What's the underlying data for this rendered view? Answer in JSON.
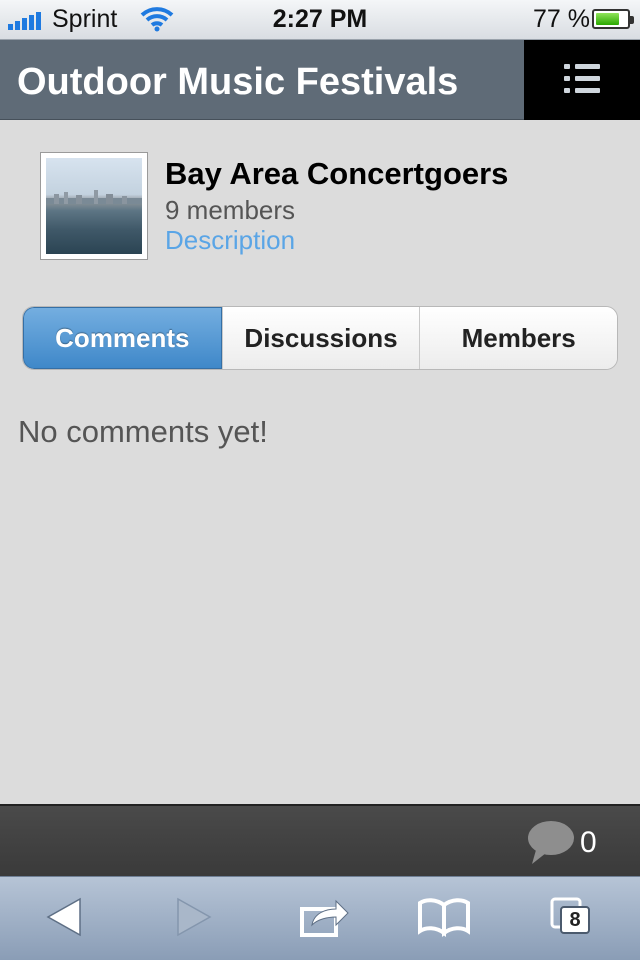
{
  "status_bar": {
    "carrier": "Sprint",
    "time": "2:27 PM",
    "battery_percent": "77 %",
    "battery_level": 0.77,
    "icons": [
      "signal-icon",
      "wifi-icon",
      "battery-icon"
    ]
  },
  "header": {
    "title": "Outdoor Music Festivals",
    "menu_icon": "list-menu-icon"
  },
  "group": {
    "name": "Bay Area Concertgoers",
    "members": "9 members",
    "description_link": "Description"
  },
  "tabs": [
    {
      "label": "Comments",
      "active": true
    },
    {
      "label": "Discussions",
      "active": false
    },
    {
      "label": "Members",
      "active": false
    }
  ],
  "content": {
    "empty_message": "No comments yet!"
  },
  "comments_bar": {
    "count": "0",
    "icon": "speech-bubble-icon"
  },
  "browser_toolbar": {
    "icons": [
      "back-arrow-icon",
      "forward-arrow-icon",
      "share-icon",
      "bookmarks-icon",
      "tabs-icon"
    ],
    "tabs_count": "8"
  },
  "colors": {
    "header_bg": "#5f6b77",
    "active_tab": "#4a90d0",
    "link": "#5aa5e6",
    "page_bg": "#dcdcdc"
  }
}
